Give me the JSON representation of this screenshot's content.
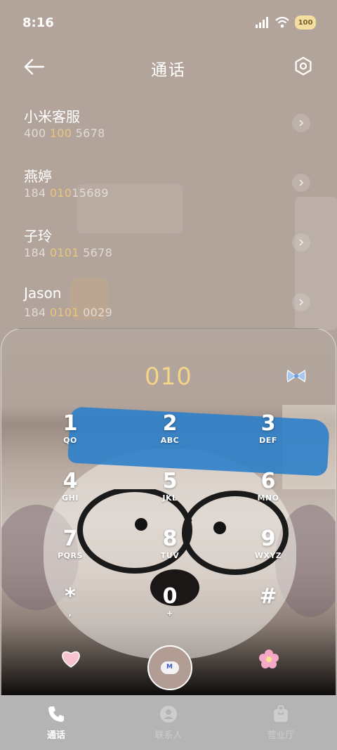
{
  "status_bar": {
    "time": "8:16",
    "badge": "100"
  },
  "header": {
    "title": "通话"
  },
  "recent_calls": [
    {
      "name": "小米客服",
      "number_pre": "400 ",
      "number_hl": "100",
      "number_post": " 5678"
    },
    {
      "name": "燕婷",
      "number_pre": "184 ",
      "number_hl": "010",
      "number_post": "15689"
    },
    {
      "name": "子玲",
      "number_pre": "184 ",
      "number_hl": "0101",
      "number_post": " 5678"
    },
    {
      "name": "Jason",
      "number_pre": "184 ",
      "number_hl": "0101",
      "number_post": " 0029"
    }
  ],
  "dialer": {
    "input": "010",
    "keys": [
      {
        "digit": "1",
        "letters": "QO"
      },
      {
        "digit": "2",
        "letters": "ABC"
      },
      {
        "digit": "3",
        "letters": "DEF"
      },
      {
        "digit": "4",
        "letters": "GHI"
      },
      {
        "digit": "5",
        "letters": "JKL"
      },
      {
        "digit": "6",
        "letters": "MNO"
      },
      {
        "digit": "7",
        "letters": "PQRS"
      },
      {
        "digit": "8",
        "letters": "TUV"
      },
      {
        "digit": "9",
        "letters": "WXYZ"
      },
      {
        "digit": "*",
        "letters": ","
      },
      {
        "digit": "0",
        "letters": "+"
      },
      {
        "digit": "#",
        "letters": ""
      }
    ]
  },
  "nav": [
    {
      "label": "通话"
    },
    {
      "label": "联系人"
    },
    {
      "label": "营业厅"
    }
  ],
  "colors": {
    "accent": "#f3d488",
    "highlight": "#e8c67a",
    "nav_bg": "#b4b4b4"
  }
}
